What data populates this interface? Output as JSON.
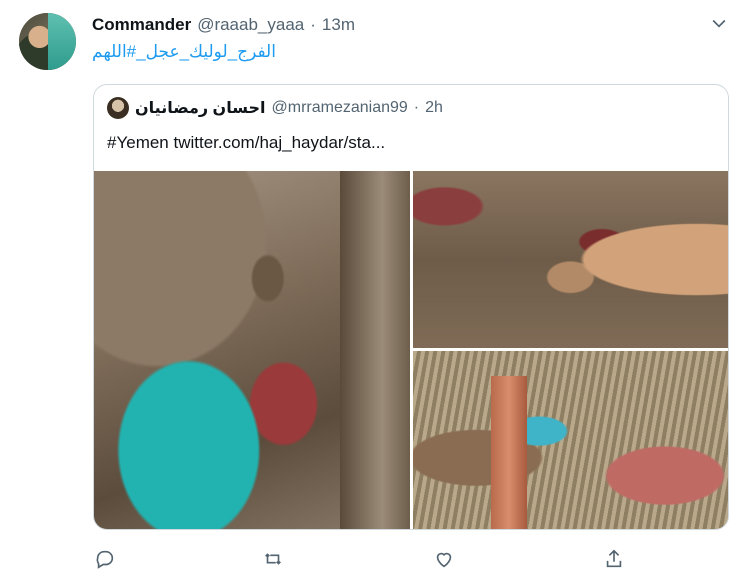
{
  "tweet": {
    "author_name": "Commander",
    "handle": "@raaab_yaaa",
    "dot": "·",
    "time": "13m",
    "text": "الفرج_لوليك_عجل_#اللهم"
  },
  "quoted": {
    "author_name": "احسان رمضانیان",
    "handle": "@mrramezanian99",
    "dot": "·",
    "time": "2h",
    "text": "#Yemen twitter.com/haj_haydar/sta..."
  },
  "icons": {
    "caret": "chevron-down-icon",
    "reply": "reply-icon",
    "retweet": "retweet-icon",
    "like": "like-icon",
    "share": "share-icon"
  },
  "colors": {
    "link": "#1d9bf0",
    "secondary_text": "#536471",
    "border": "#cfd9de"
  }
}
